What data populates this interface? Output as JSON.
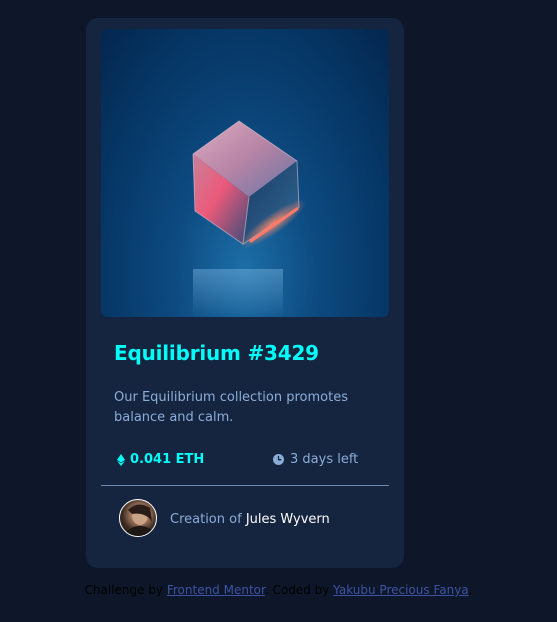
{
  "card": {
    "image_alt": "Equilibrium",
    "title": "Equilibrium #3429",
    "description": "Our Equilibrium collection promotes balance and calm.",
    "price": "0.041 ETH",
    "time_left": "3 days left",
    "creator_prefix": "Creation of ",
    "creator_name": "Jules Wyvern",
    "price_icon": "ethereum-icon",
    "time_icon": "clock-icon"
  },
  "attribution": {
    "prefix": "Challenge by ",
    "link1": "Frontend Mentor",
    "middle": ". Coded by ",
    "link2": "Yakubu Precious Fanya",
    "suffix": "."
  },
  "colors": {
    "background": "#0d1729",
    "card": "#15253f",
    "cyan": "#00fff8",
    "soft_blue": "#8bacd9",
    "white": "#ffffff"
  }
}
